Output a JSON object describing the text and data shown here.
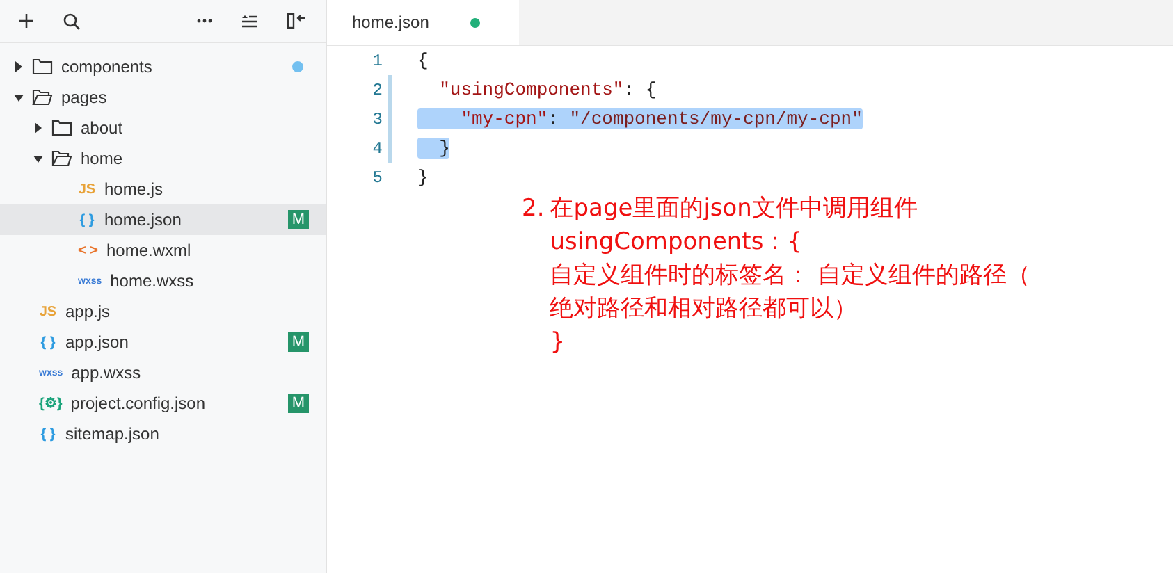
{
  "sidebar": {
    "tree": [
      {
        "label": "components",
        "kind": "folder",
        "expanded": false,
        "selected": false,
        "changed": true
      },
      {
        "label": "pages",
        "kind": "folder",
        "expanded": true,
        "selected": false,
        "changed": false,
        "children": [
          {
            "label": "about",
            "kind": "folder",
            "expanded": false,
            "selected": false,
            "changed": false
          },
          {
            "label": "home",
            "kind": "folder",
            "expanded": true,
            "selected": false,
            "changed": false,
            "children": [
              {
                "label": "home.js",
                "kind": "js",
                "icon": "JS",
                "selected": false,
                "changed": false
              },
              {
                "label": "home.json",
                "kind": "json",
                "icon": "{ }",
                "selected": true,
                "changed": false,
                "badge": "M"
              },
              {
                "label": "home.wxml",
                "kind": "wxml",
                "icon": "< >",
                "selected": false,
                "changed": false
              },
              {
                "label": "home.wxss",
                "kind": "wxss",
                "icon": "wxss",
                "selected": false,
                "changed": false
              }
            ]
          }
        ]
      },
      {
        "label": "app.js",
        "kind": "js",
        "icon": "JS",
        "selected": false,
        "changed": false
      },
      {
        "label": "app.json",
        "kind": "json",
        "icon": "{ }",
        "selected": false,
        "changed": false,
        "badge": "M"
      },
      {
        "label": "app.wxss",
        "kind": "wxss",
        "icon": "wxss",
        "selected": false,
        "changed": false
      },
      {
        "label": "project.config.json",
        "kind": "config",
        "icon": "{⚙}",
        "selected": false,
        "changed": false,
        "badge": "M"
      },
      {
        "label": "sitemap.json",
        "kind": "json",
        "icon": "{ }",
        "selected": false,
        "changed": false
      }
    ]
  },
  "tab": {
    "label": "home.json",
    "modified": true
  },
  "code": [
    {
      "number": "1",
      "modified": false,
      "selected": false,
      "tokens": [
        {
          "kind": "punct",
          "text": "{"
        }
      ]
    },
    {
      "number": "2",
      "modified": true,
      "selected": false,
      "tokens": [
        {
          "kind": "key",
          "text": "  \"usingComponents\""
        },
        {
          "kind": "punct",
          "text": ": {"
        }
      ]
    },
    {
      "number": "3",
      "modified": true,
      "selected": true,
      "tokens": [
        {
          "kind": "key",
          "text": "    \"my-cpn\""
        },
        {
          "kind": "punct",
          "text": ": "
        },
        {
          "kind": "string",
          "text": "\"/components/my-cpn/my-cpn\""
        }
      ]
    },
    {
      "number": "4",
      "modified": true,
      "selected": true,
      "tokens": [
        {
          "kind": "punct",
          "text": "  }"
        }
      ]
    },
    {
      "number": "5",
      "modified": false,
      "selected": false,
      "tokens": [
        {
          "kind": "punct",
          "text": "}"
        }
      ]
    }
  ],
  "annotation": {
    "number": "2.",
    "lines": [
      "在page里面的json文件中调用组件",
      "usingComponents：{",
      "自定义组件时的标签名： 自定义组件的路径（",
      "绝对路径和相对路径都可以）",
      "}"
    ]
  }
}
